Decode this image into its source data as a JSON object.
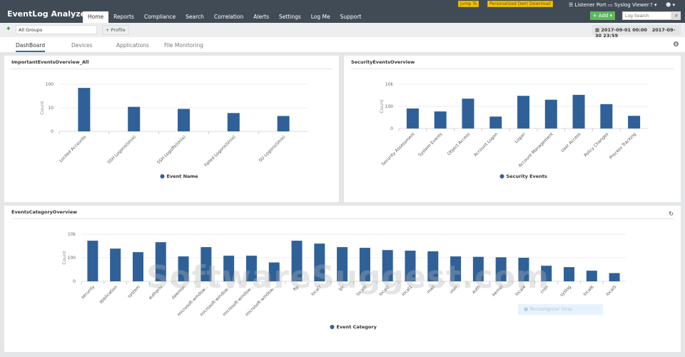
{
  "header": {
    "app_title": "EventLog Analyzer",
    "nav": [
      "Home",
      "Reports",
      "Compliance",
      "Search",
      "Correlation",
      "Alerts",
      "Settings",
      "Log Me",
      "Support"
    ],
    "active_nav": "Home",
    "promos": {
      "jump_to": "Jump To",
      "demo": "Personalized Demo",
      "download": "Download"
    },
    "listener_port": "Listener Port",
    "syslog_viewer": "Syslog Viewer",
    "help": "? ▾",
    "user": "☻ ▾",
    "add_label": "+ Add ▾",
    "search_placeholder": "Log Search"
  },
  "toolbar": {
    "group": "All Groups",
    "profile": "+ Profile",
    "date_from": "2017-09-01 00:00",
    "date_to": "2017-09-30 23:59"
  },
  "tabs": [
    "DashBoard",
    "Devices",
    "Applications",
    "File Monitoring"
  ],
  "colors": {
    "bar": "#2f6198",
    "header": "#414b55",
    "add": "#5cb85c"
  },
  "watermark": "SoftwareSuggest.com",
  "overlay": "Rectangular Snip",
  "chart_data": [
    {
      "type": "bar",
      "title": "ImportantEventsOverview_All",
      "ylabel": "Count",
      "yscale": "log",
      "yticks": [
        "0",
        "10",
        "100"
      ],
      "legend": "Event Name",
      "legend_placement": "bottom",
      "categories": [
        "Locked Accounts",
        "SSH Logons(Unix)",
        "SSH Logoffs(Unix)",
        "Failed Logons(Unix)",
        "SU Logons(Unix)"
      ],
      "values": [
        70,
        11,
        9,
        6,
        4.5
      ]
    },
    {
      "type": "bar",
      "title": "SecurityEventsOverview",
      "ylabel": "Count",
      "yscale": "log",
      "yticks": [
        "0",
        "100",
        "10k"
      ],
      "legend": "Security Events",
      "legend_placement": "bottom",
      "categories": [
        "Security Assessment",
        "System Events",
        "Object Access",
        "Account Logon",
        "Logon",
        "Account Management",
        "User Access",
        "Policy Changes",
        "Process Tracking"
      ],
      "values": [
        65,
        35,
        500,
        12,
        900,
        400,
        1100,
        160,
        14
      ]
    },
    {
      "type": "bar",
      "title": "EventsCategoryOverview",
      "ylabel": "Count",
      "yscale": "log",
      "yticks": [
        "0",
        "100",
        "10k"
      ],
      "legend": "Event Category",
      "legend_placement": "bottom",
      "categories": [
        "security",
        "application",
        "system",
        "authpriv",
        "daemon",
        "microsoft-window...",
        "microsoft-window...",
        "microsoft-window...",
        "microsoft-window...",
        "ftp",
        "local7",
        "lpr",
        "local0",
        "local2",
        "local1",
        "mail",
        "user",
        "auth",
        "kernel",
        "local4",
        "cron",
        "syslog",
        "local6",
        "local5"
      ],
      "values": [
        2800,
        600,
        300,
        2100,
        130,
        800,
        150,
        150,
        40,
        2800,
        1600,
        800,
        700,
        450,
        400,
        350,
        130,
        120,
        110,
        100,
        21,
        16,
        8,
        5
      ]
    }
  ]
}
